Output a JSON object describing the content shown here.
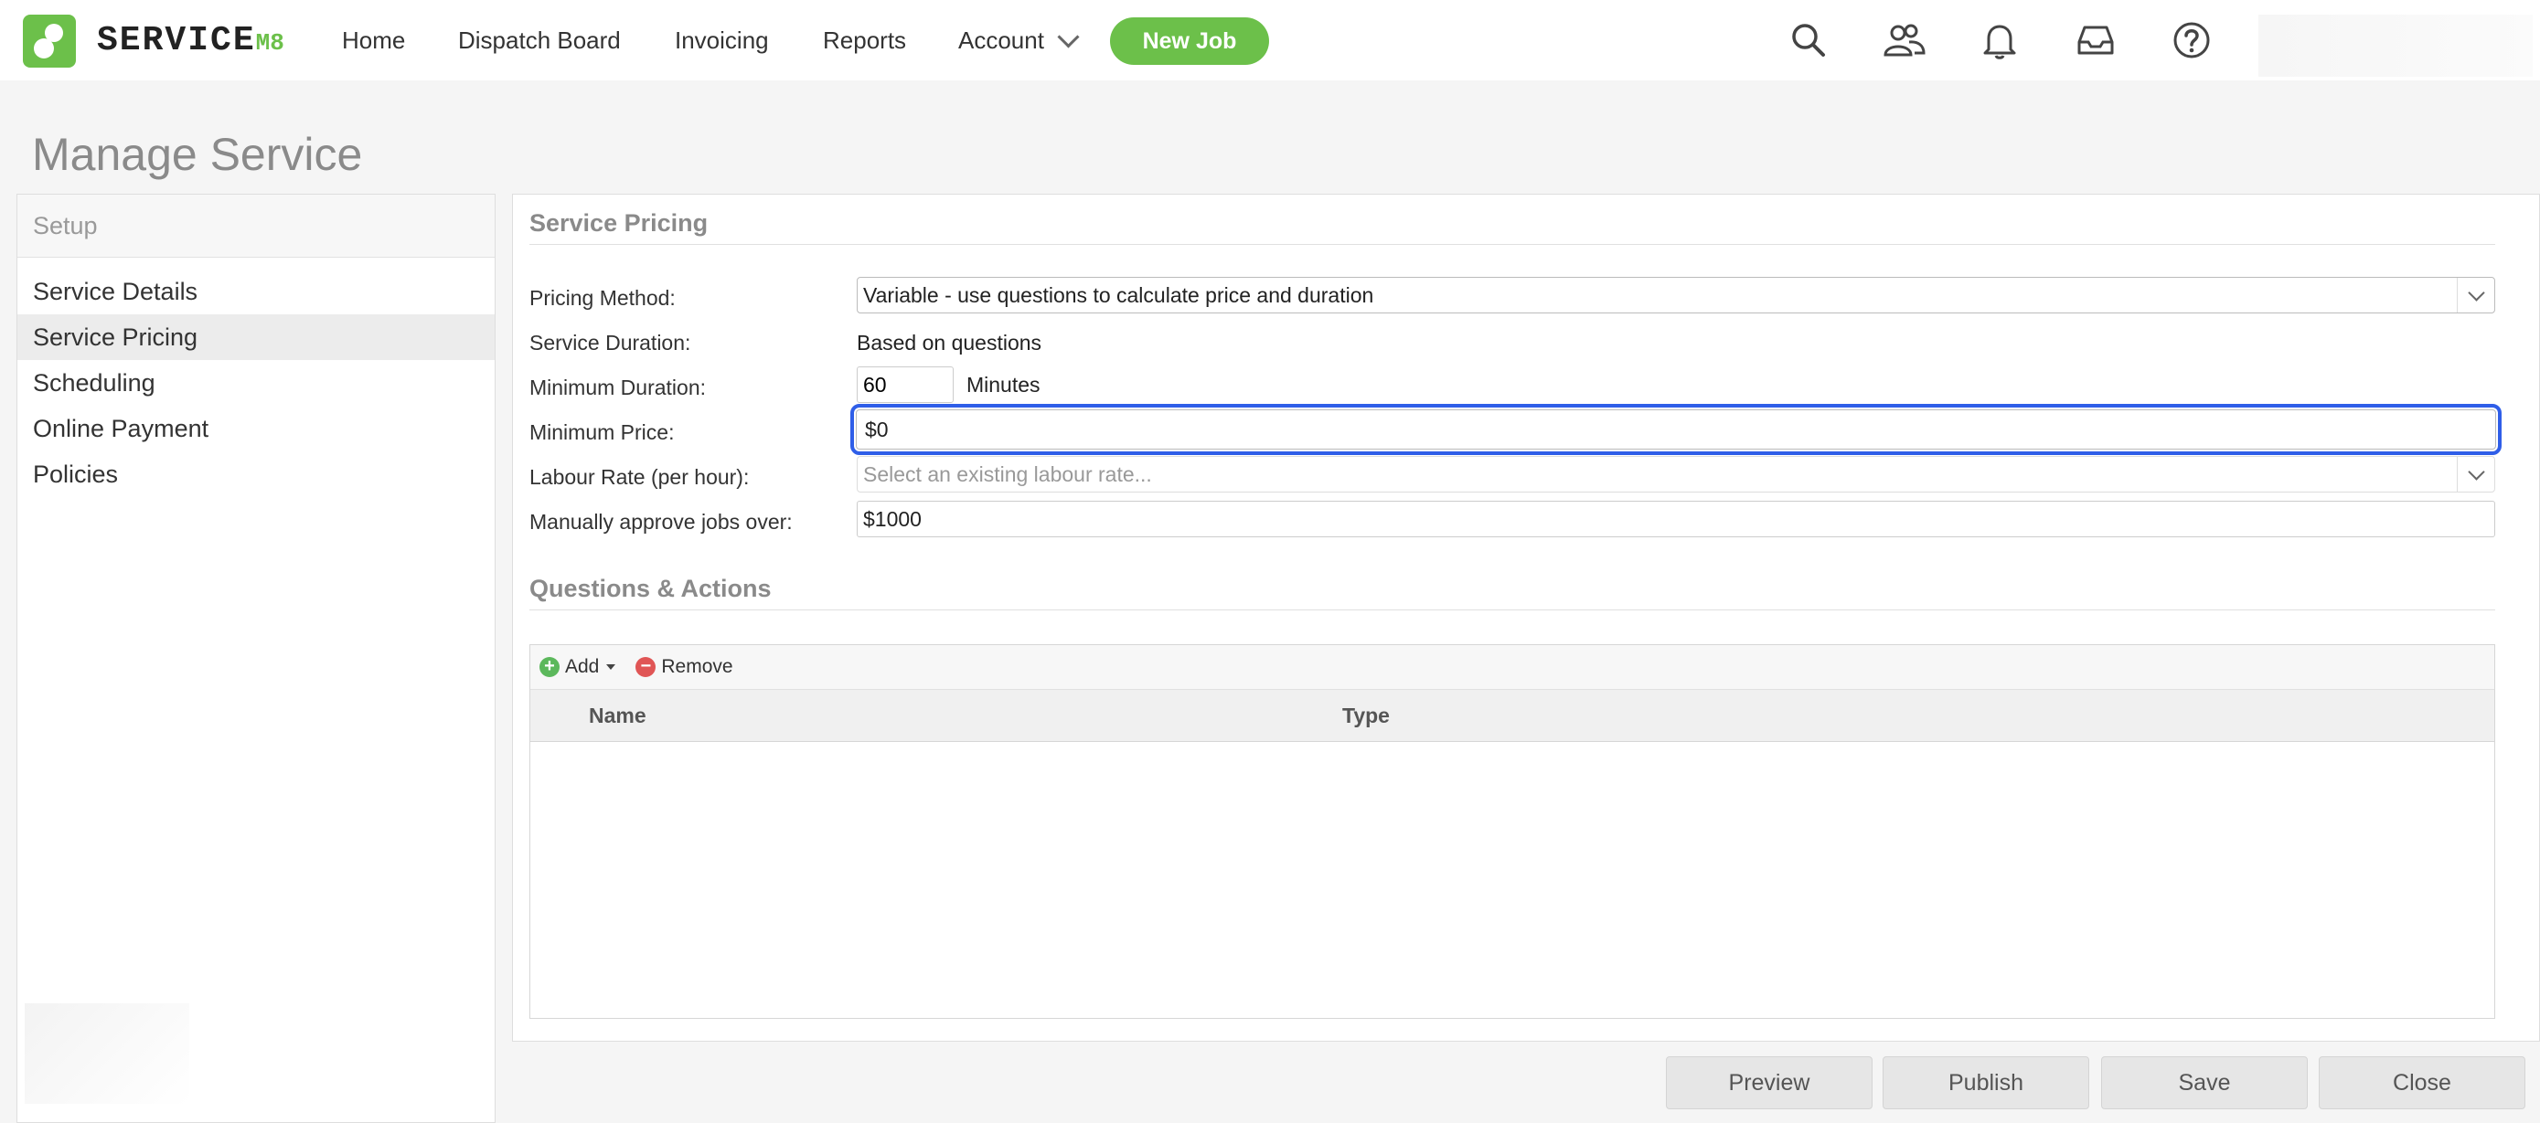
{
  "app": {
    "logo_text": "SERVICE",
    "logo_suffix": "M8"
  },
  "nav": {
    "home": "Home",
    "dispatch": "Dispatch Board",
    "invoicing": "Invoicing",
    "reports": "Reports",
    "account": "Account",
    "new_job": "New Job",
    "icons": [
      "search-icon",
      "people-icon",
      "bell-icon",
      "inbox-icon",
      "help-icon"
    ]
  },
  "page": {
    "title": "Manage Service"
  },
  "sidebar": {
    "header": "Setup",
    "items": [
      "Service Details",
      "Service Pricing",
      "Scheduling",
      "Online Payment",
      "Policies"
    ],
    "active": "Service Pricing"
  },
  "pricing": {
    "title": "Service Pricing",
    "method_label": "Pricing Method:",
    "method_value": "Variable - use questions to calculate price and duration",
    "duration_label": "Service Duration:",
    "duration_value": "Based on questions",
    "min_duration_label": "Minimum Duration:",
    "min_duration_value": "60",
    "min_duration_unit": "Minutes",
    "min_price_label": "Minimum Price:",
    "min_price_value": "$0",
    "labour_label": "Labour Rate (per hour):",
    "labour_placeholder": "Select an existing labour rate...",
    "approve_label": "Manually approve jobs over:",
    "approve_value": "$1000"
  },
  "questions": {
    "title": "Questions & Actions",
    "add": "Add",
    "remove": "Remove",
    "col_name": "Name",
    "col_type": "Type"
  },
  "footer": {
    "preview": "Preview",
    "publish": "Publish",
    "save": "Save",
    "close": "Close"
  },
  "colors": {
    "brand_green": "#6cc04a",
    "focus_blue": "#2f5ee8"
  }
}
